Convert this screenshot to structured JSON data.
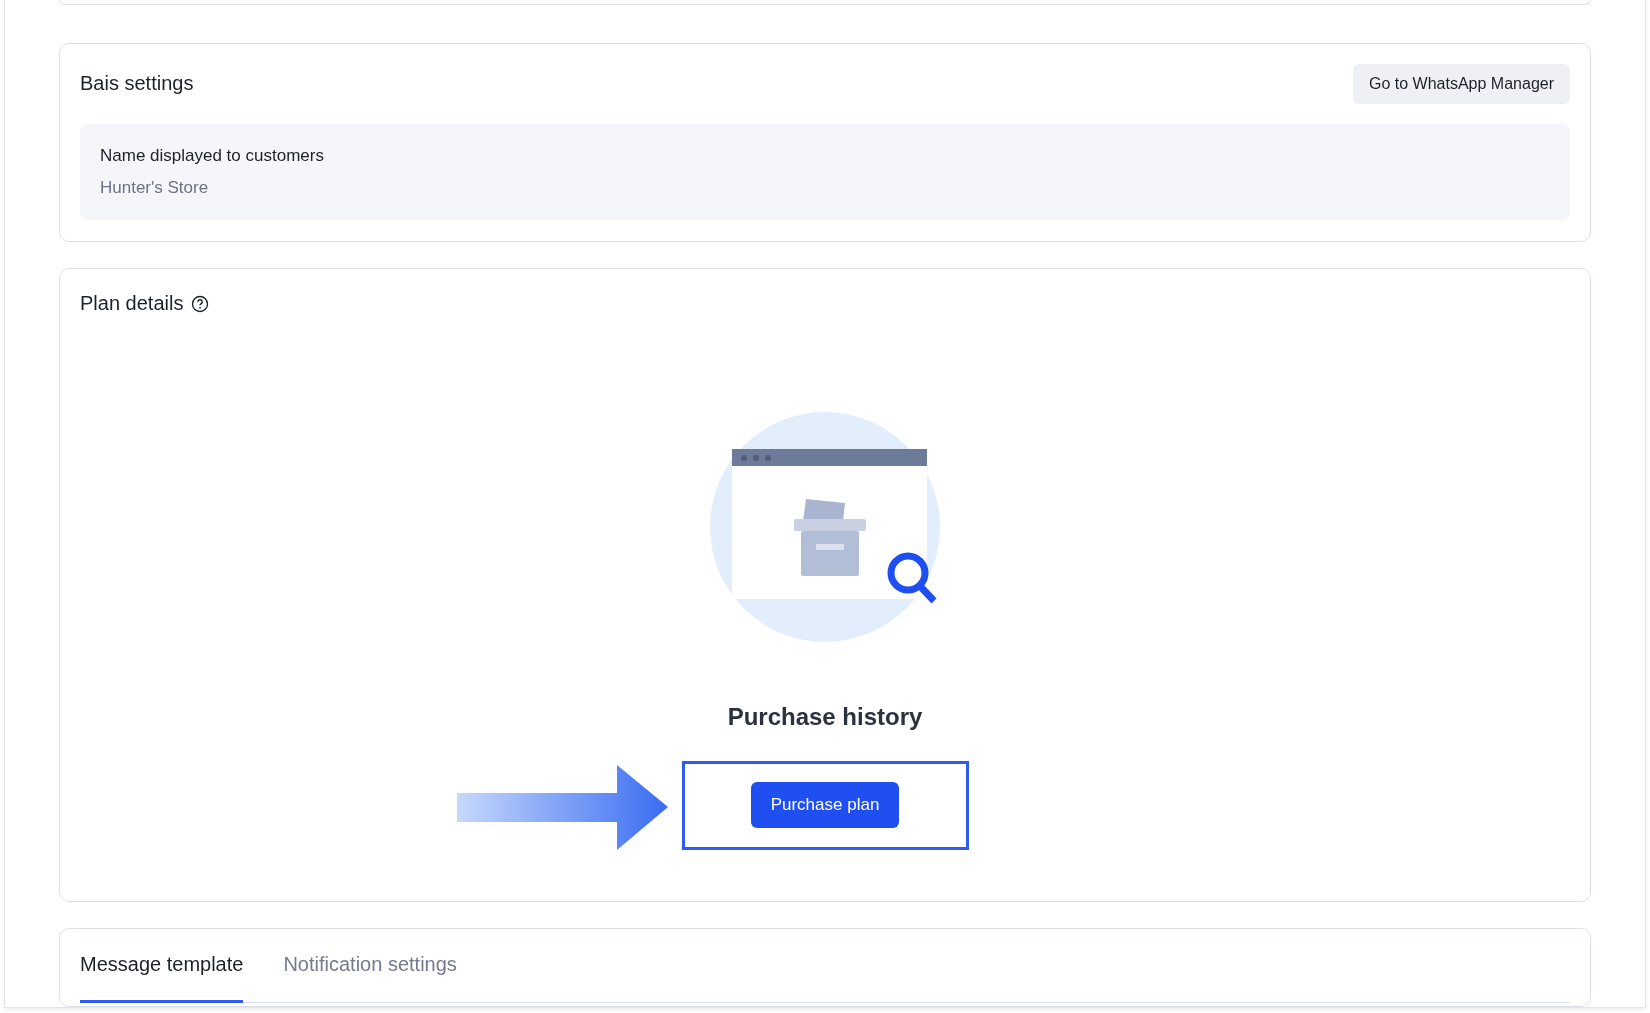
{
  "basic_settings": {
    "title": "Bais settings",
    "manager_button": "Go to WhatsApp Manager",
    "field_label": "Name displayed to customers",
    "field_value": "Hunter's Store"
  },
  "plan_details": {
    "title": "Plan details",
    "empty_title": "Purchase history",
    "purchase_button": "Purchase plan"
  },
  "tabs": [
    {
      "label": "Message template",
      "selected": true
    },
    {
      "label": "Notification settings",
      "selected": false
    }
  ]
}
